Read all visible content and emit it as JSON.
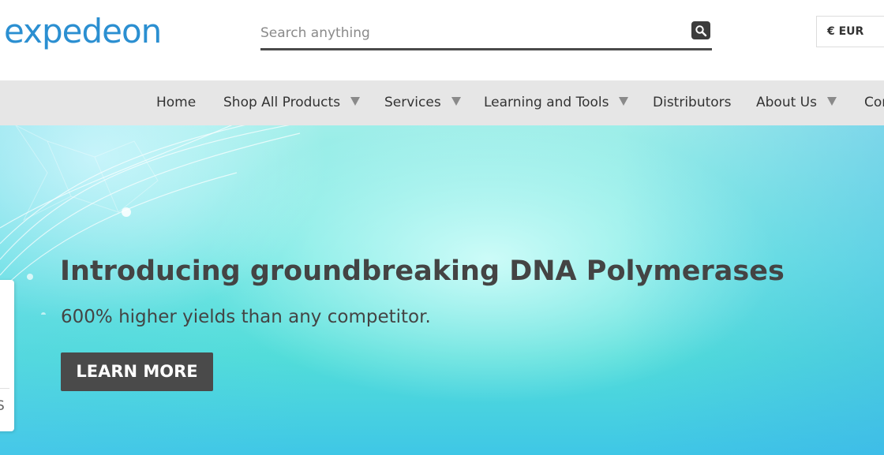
{
  "header": {
    "logo_text": "expedeon",
    "search": {
      "placeholder": "Search anything",
      "value": ""
    },
    "currency": "€ EUR"
  },
  "nav": {
    "items": [
      {
        "label": "Home",
        "has_dropdown": false
      },
      {
        "label": "Shop All Products",
        "has_dropdown": true
      },
      {
        "label": "Services",
        "has_dropdown": true
      },
      {
        "label": "Learning and Tools",
        "has_dropdown": true
      },
      {
        "label": "Distributors",
        "has_dropdown": false
      },
      {
        "label": "About Us",
        "has_dropdown": true
      },
      {
        "label": "Cor",
        "has_dropdown": false
      }
    ]
  },
  "hero": {
    "title": "Introducing groundbreaking DNA Polymerases",
    "subtitle": "600% higher yields than any competitor.",
    "cta_label": "LEARN MORE"
  },
  "side_tab": {
    "label": "S"
  },
  "colors": {
    "logo": "#2b8fd1",
    "nav_bg": "#e6e6e6",
    "cta_bg": "#4a4a4a",
    "hero_text": "#444444",
    "hero_bg": "#74e8e2"
  },
  "icons": {
    "search": "search-icon",
    "dropdown": "caret-down-icon"
  }
}
